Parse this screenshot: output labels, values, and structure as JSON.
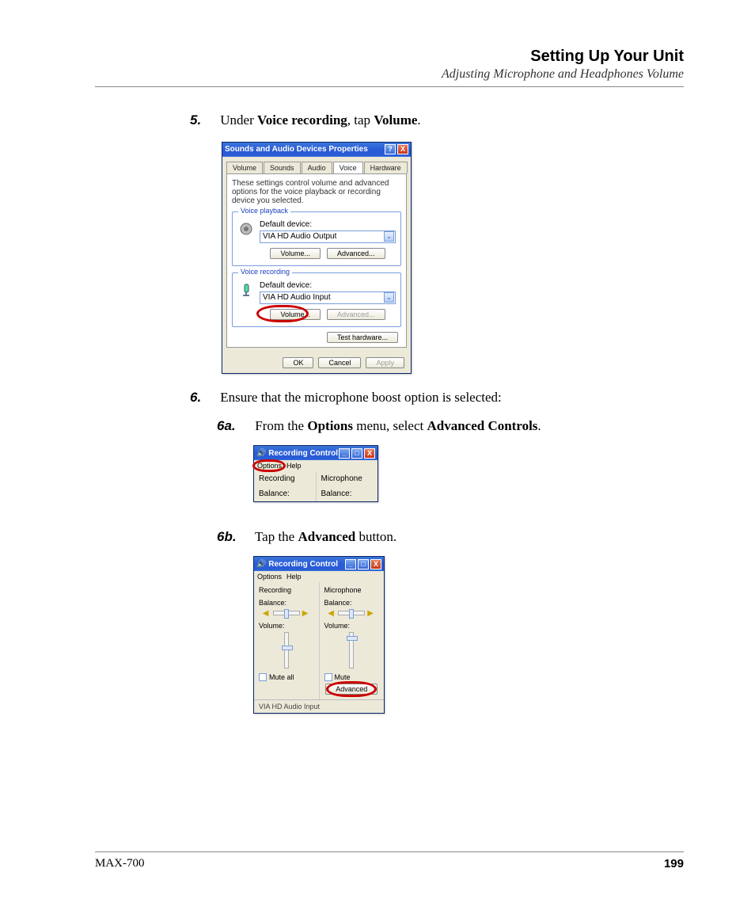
{
  "header": {
    "title": "Setting Up Your Unit",
    "subtitle": "Adjusting Microphone and Headphones Volume"
  },
  "step5": {
    "num": "5.",
    "t1": "Under ",
    "b1": "Voice recording",
    "t2": ", tap ",
    "b2": "Volume",
    "t3": "."
  },
  "step6": {
    "num": "6.",
    "t1": "Ensure that the microphone boost option is selected:"
  },
  "step6a": {
    "num": "6a.",
    "t1": "From the ",
    "b1": "Options",
    "t2": " menu, select ",
    "b2": "Advanced Controls",
    "t3": "."
  },
  "step6b": {
    "num": "6b.",
    "t1": "Tap the ",
    "b1": "Advanced",
    "t2": " button."
  },
  "dlg1": {
    "title": "Sounds and Audio Devices Properties",
    "help": "?",
    "close": "X",
    "tabs": {
      "volume": "Volume",
      "sounds": "Sounds",
      "audio": "Audio",
      "voice": "Voice",
      "hardware": "Hardware"
    },
    "desc": "These settings control volume and advanced options for the voice playback or recording device you selected.",
    "playback": {
      "legend": "Voice playback",
      "label": "Default device:",
      "device": "VIA HD Audio Output",
      "volume": "Volume...",
      "advanced": "Advanced..."
    },
    "recording": {
      "legend": "Voice recording",
      "label": "Default device:",
      "device": "VIA HD Audio Input",
      "volume": "Volume...",
      "advanced": "Advanced..."
    },
    "test": "Test hardware...",
    "ok": "OK",
    "cancel": "Cancel",
    "apply": "Apply"
  },
  "dlg2": {
    "title": "Recording Control",
    "min": "_",
    "max": "□",
    "close": "X",
    "menu": {
      "options": "Options",
      "help": "Help"
    },
    "cols": {
      "rec": "Recording",
      "mic": "Microphone",
      "bal": "Balance:"
    }
  },
  "dlg3": {
    "title": "Recording Control",
    "min": "_",
    "max": "□",
    "close": "X",
    "menu": {
      "options": "Options",
      "help": "Help"
    },
    "cols": {
      "rec": "Recording",
      "mic": "Microphone",
      "bal": "Balance:",
      "vol": "Volume:"
    },
    "muteall": "Mute all",
    "mute": "Mute",
    "advanced": "Advanced",
    "status": "VIA HD Audio Input"
  },
  "footer": {
    "model": "MAX-700",
    "page": "199"
  }
}
